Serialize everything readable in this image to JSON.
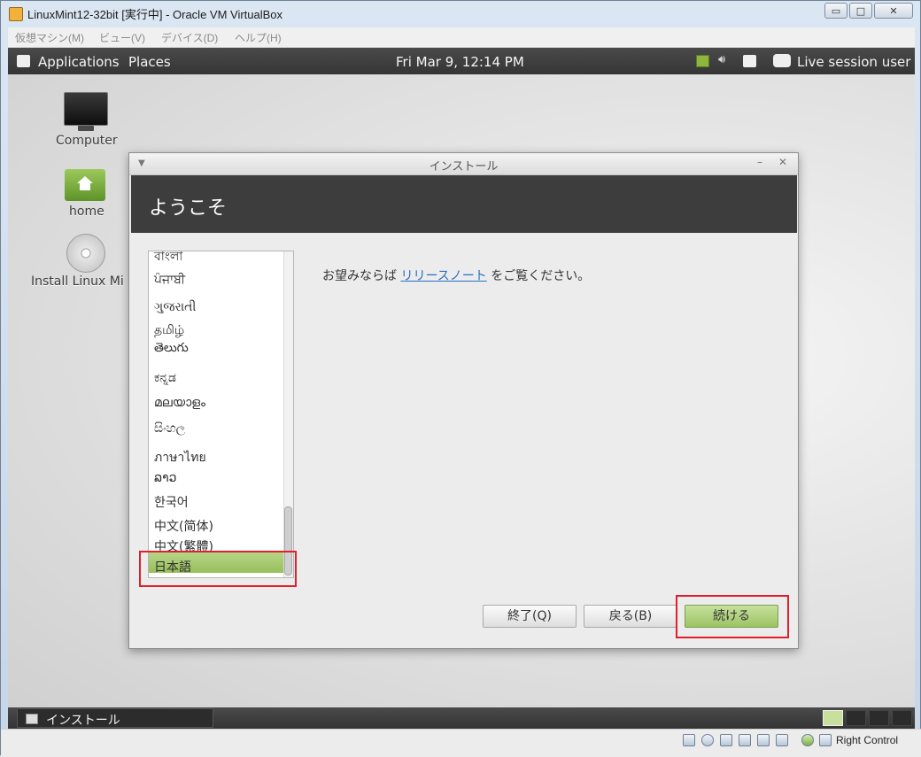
{
  "window": {
    "title": "LinuxMint12-32bit [実行中] - Oracle VM VirtualBox",
    "controls": {
      "minimize": "▭",
      "maximize": "□",
      "close": "✕"
    }
  },
  "vbox_menu": [
    "仮想マシン(M)",
    "ビュー(V)",
    "デバイス(D)",
    "ヘルプ(H)"
  ],
  "top_panel": {
    "applications": "Applications",
    "places": "Places",
    "clock": "Fri Mar  9, 12:14 PM",
    "user": "Live session user",
    "tray_icons": [
      "network-icon",
      "volume-icon",
      "battery-icon",
      "chat-icon"
    ]
  },
  "desktop": {
    "icons": [
      {
        "label": "Computer",
        "icon": "monitor-icon"
      },
      {
        "label": "home",
        "icon": "home-folder-icon"
      },
      {
        "label": "Install Linux Mi",
        "icon": "disc-icon"
      }
    ]
  },
  "installer": {
    "title": "インストール",
    "heading": "ようこそ",
    "languages": [
      "বাংলা",
      "ਪੰਜਾਬੀ",
      "ગુજરાતી",
      "தமிழ்",
      "తెలుగు",
      "ಕನ್ನಡ",
      "മലയാളം",
      "සිංහල",
      "ภาษาไทย",
      "ລາວ",
      "한국어",
      "中文(简体)",
      "中文(繁體)",
      "日本語"
    ],
    "selected_language": "日本語",
    "release_prefix": "お望みならば",
    "release_link": "リリースノート",
    "release_suffix": "をご覧ください。",
    "buttons": {
      "quit": "終了(Q)",
      "back": "戻る(B)",
      "continue": "続ける"
    }
  },
  "bottom_panel": {
    "task": "インストール",
    "workspaces": 4,
    "active_workspace": 1
  },
  "status_bar": {
    "host_key": "Right Control"
  },
  "colors": {
    "highlight": "#e0202a",
    "mint_green": "#9cc364",
    "panel": "#3d3d3d"
  }
}
